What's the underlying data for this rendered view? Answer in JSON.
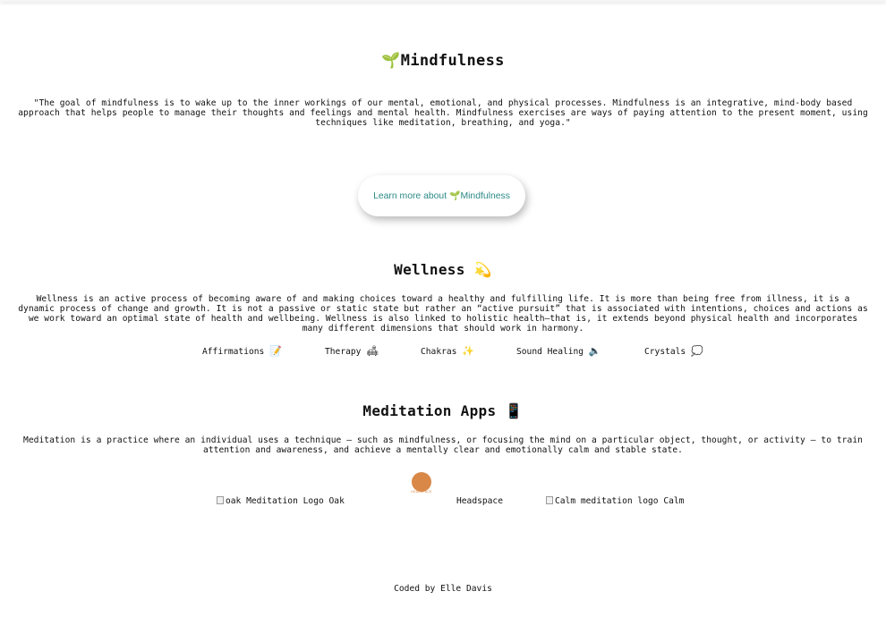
{
  "header": {
    "title_icon": "🌱",
    "title": "Mindfulness",
    "quote": "\"The goal of mindfulness is to wake up to the inner workings of our mental, emotional, and physical processes. Mindfulness is an integrative, mind-body based approach that helps people to manage their thoughts and feelings and mental health. Mindfulness exercises are ways of paying attention to the present moment, using techniques like meditation, breathing, and yoga.\""
  },
  "learn_button": {
    "label_prefix": "Learn more about ",
    "icon": "🌱",
    "label_suffix": "Mindfulness",
    "color": "#2c8a86"
  },
  "wellness": {
    "title": "Wellness",
    "title_icon": "💫",
    "text": "Wellness is an active process of becoming aware of and making choices toward a healthy and fulfilling life. It is more than being free from illness, it is a dynamic process of change and growth. It is not a passive or static state but rather an “active pursuit” that is associated with intentions, choices and actions as we work toward an optimal state of health and wellbeing. Wellness is also linked to holistic health—that is, it extends beyond physical health and incorporates many different dimensions that should work in harmony.",
    "topics": [
      {
        "label": "Affirmations",
        "icon": "📝"
      },
      {
        "label": "Therapy",
        "icon": "🛋"
      },
      {
        "label": "Chakras",
        "icon": "✨"
      },
      {
        "label": "Sound Healing",
        "icon": "🔈"
      },
      {
        "label": "Crystals",
        "icon": "💭"
      }
    ]
  },
  "meditation": {
    "title": "Meditation Apps",
    "title_icon": "📱",
    "text": "Meditation is a practice where an individual uses a technique – such as mindfulness, or focusing the mind on a particular object, thought, or activity – to train attention and awareness, and achieve a mentally clear and emotionally calm and stable state.",
    "apps": [
      {
        "alt": "oak Meditation Logo",
        "label": "Oak"
      },
      {
        "logo_text": "HEADSPACE",
        "label": "Headspace",
        "logo_color": "#d98848"
      },
      {
        "alt": "Calm meditation logo",
        "label": "Calm"
      }
    ]
  },
  "footer": {
    "prefix": "Coded by ",
    "author": "Elle Davis"
  }
}
